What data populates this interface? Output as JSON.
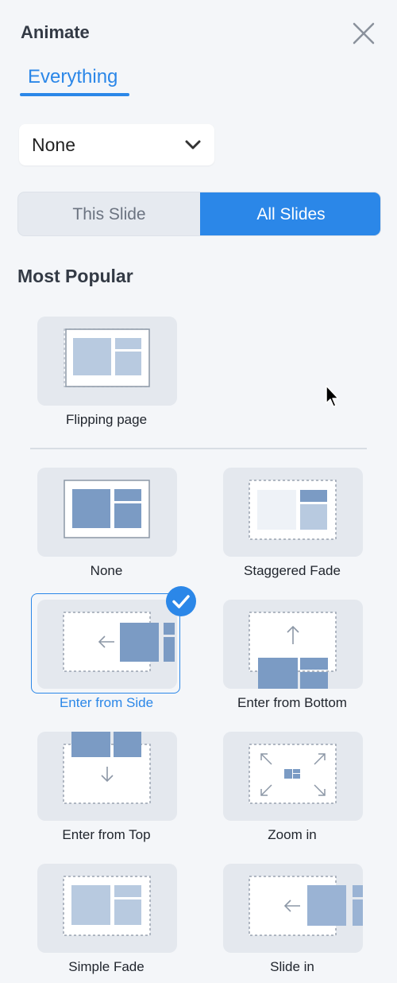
{
  "header": {
    "title": "Animate",
    "close_icon": "close-icon"
  },
  "tabs": [
    {
      "label": "Everything",
      "active": true
    }
  ],
  "dropdown": {
    "value": "None",
    "icon": "chevron-down-icon"
  },
  "scope_toggle": {
    "options": [
      "This Slide",
      "All Slides"
    ],
    "selected": "All Slides"
  },
  "section": {
    "title": "Most Popular"
  },
  "featured": [
    {
      "label": "Flipping page"
    }
  ],
  "animations": [
    {
      "label": "None"
    },
    {
      "label": "Staggered Fade"
    },
    {
      "label": "Enter from Side",
      "selected": true
    },
    {
      "label": "Enter from Bottom"
    },
    {
      "label": "Enter from Top"
    },
    {
      "label": "Zoom in"
    },
    {
      "label": "Simple Fade"
    },
    {
      "label": "Slide in"
    }
  ],
  "colors": {
    "accent": "#2b87e8",
    "block": "#7b9bc4",
    "block_light": "#b8cae0",
    "panel_bg": "#f4f6f9"
  }
}
